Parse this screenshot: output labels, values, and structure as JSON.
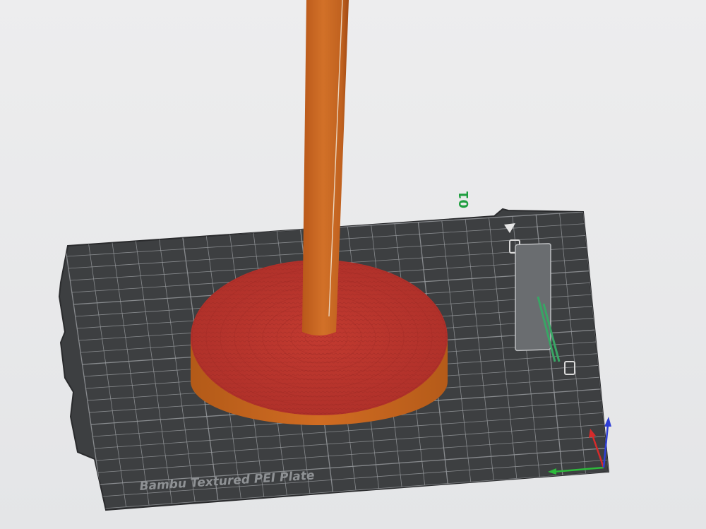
{
  "viewport": {
    "background": "#e9eaec"
  },
  "plate": {
    "name": "Bambu Textured PEI Plate",
    "number": "01",
    "surface_color": "#3d3f41",
    "grid_color": "#9a9da0",
    "number_color": "#1f9e3f"
  },
  "model": {
    "base_top_color": "#b8322c",
    "base_side_color": "#c8661e",
    "rod_color": "#cc6a22"
  },
  "axes": {
    "x_color": "#d62b2b",
    "y_color": "#2dba3b",
    "z_color": "#2f3fd6"
  }
}
